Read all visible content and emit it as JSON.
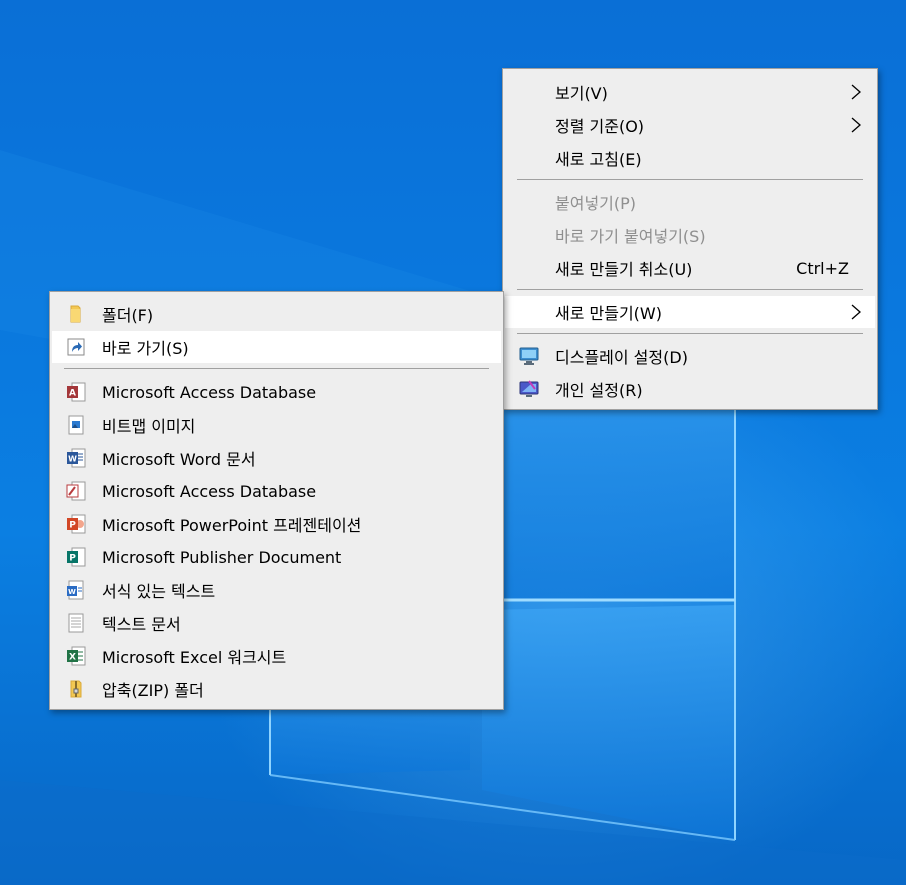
{
  "context_menu": {
    "items": [
      {
        "label": "보기(V)",
        "has_submenu": true
      },
      {
        "label": "정렬 기준(O)",
        "has_submenu": true
      },
      {
        "label": "새로 고침(E)"
      },
      {
        "label": "붙여넣기(P)",
        "disabled": true
      },
      {
        "label": "바로 가기 붙여넣기(S)",
        "disabled": true
      },
      {
        "label": "새로 만들기 취소(U)",
        "shortcut": "Ctrl+Z"
      },
      {
        "label": "새로 만들기(W)",
        "has_submenu": true,
        "highlighted": true
      },
      {
        "label": "디스플레이 설정(D)",
        "icon": "display-icon"
      },
      {
        "label": "개인 설정(R)",
        "icon": "personalize-icon"
      }
    ]
  },
  "new_submenu": {
    "items": [
      {
        "label": "폴더(F)",
        "icon": "folder-icon"
      },
      {
        "label": "바로 가기(S)",
        "icon": "shortcut-icon",
        "highlighted": true
      },
      {
        "label": "Microsoft Access Database",
        "icon": "access-icon"
      },
      {
        "label": "비트맵 이미지",
        "icon": "bitmap-icon"
      },
      {
        "label": "Microsoft Word 문서",
        "icon": "word-icon"
      },
      {
        "label": "Microsoft Access Database",
        "icon": "access-icon"
      },
      {
        "label": "Microsoft PowerPoint 프레젠테이션",
        "icon": "powerpoint-icon"
      },
      {
        "label": "Microsoft Publisher Document",
        "icon": "publisher-icon"
      },
      {
        "label": "서식 있는 텍스트",
        "icon": "wordpad-icon"
      },
      {
        "label": "텍스트 문서",
        "icon": "text-document-icon"
      },
      {
        "label": "Microsoft Excel 워크시트",
        "icon": "excel-icon"
      },
      {
        "label": "압축(ZIP) 폴더",
        "icon": "zip-folder-icon"
      }
    ]
  },
  "colors": {
    "desktop_blue": "#0a78de",
    "menu_bg": "#eeeeee",
    "highlight": "#ffffff",
    "disabled_text": "#8f8f8f"
  }
}
